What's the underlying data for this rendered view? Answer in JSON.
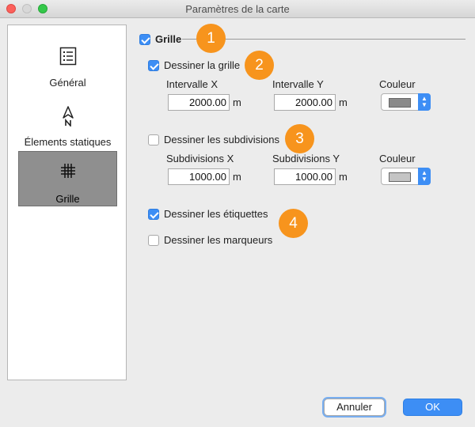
{
  "window": {
    "title": "Paramètres de la carte"
  },
  "sidebar": {
    "items": [
      {
        "label": "Général",
        "icon": "list-icon",
        "selected": false
      },
      {
        "label": "Élements statiques",
        "icon": "north-arrow-icon",
        "selected": false
      },
      {
        "label": "Grille",
        "icon": "grid-icon",
        "selected": true
      }
    ]
  },
  "grid_section": {
    "label": "Grille",
    "checked": true
  },
  "draw_grid": {
    "label": "Dessiner la grille",
    "checked": true,
    "x_label": "Intervalle X",
    "y_label": "Intervalle Y",
    "x_value": "2000.00",
    "y_value": "2000.00",
    "unit_x": "m",
    "unit_y": "m",
    "color_label": "Couleur",
    "color": "#8a8a8a"
  },
  "draw_subdivisions": {
    "label": "Dessiner les subdivisions",
    "checked": false,
    "x_label": "Subdivisions X",
    "y_label": "Subdivisions Y",
    "x_value": "1000.00",
    "y_value": "1000.00",
    "unit_x": "m",
    "unit_y": "m",
    "color_label": "Couleur",
    "color": "#c4c4c4"
  },
  "draw_labels": {
    "label": "Dessiner les étiquettes",
    "checked": true
  },
  "draw_markers": {
    "label": "Dessiner les marqueurs",
    "checked": false
  },
  "badges": [
    "1",
    "2",
    "3",
    "4"
  ],
  "buttons": {
    "cancel": "Annuler",
    "ok": "OK"
  },
  "colors": {
    "accent": "#3d8ef5",
    "badge": "#f7941d"
  }
}
